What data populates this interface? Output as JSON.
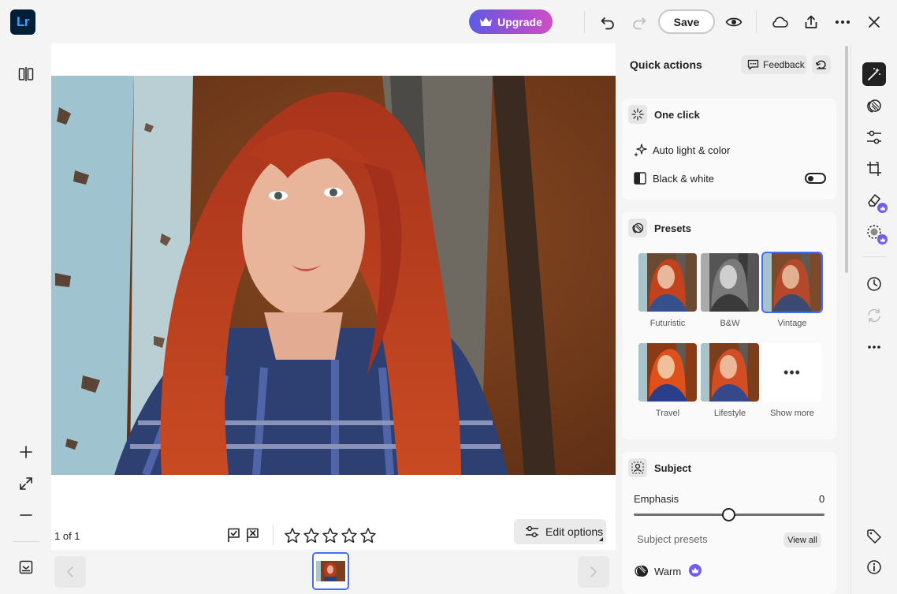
{
  "app": {
    "logo_text": "Lr",
    "upgrade_label": "Upgrade",
    "save_label": "Save",
    "accent": "#4a6cf0",
    "upgrade_gradient": [
      "#5c5ce0",
      "#d04fc4"
    ]
  },
  "toolbar_icons": [
    "undo-icon",
    "redo-icon",
    "eye-icon",
    "cloud-icon",
    "share-icon",
    "more-icon",
    "close-icon"
  ],
  "left_rail_icons": [
    "compare-icon",
    "zoom-in-icon",
    "fit-icon",
    "zoom-out-icon",
    "filmstrip-toggle-icon"
  ],
  "canvas": {
    "counter": "1 of 1",
    "flag_icons": [
      "pick-flag-icon",
      "reject-flag-icon"
    ],
    "stars": 5,
    "rating": 0,
    "edit_options_label": "Edit options"
  },
  "panel": {
    "title": "Quick actions",
    "feedback_label": "Feedback",
    "one_click": {
      "title": "One click",
      "auto_label": "Auto light & color",
      "bw_label": "Black & white",
      "bw_on": false
    },
    "presets": {
      "title": "Presets",
      "items": [
        {
          "label": "Futuristic",
          "style": "futuristic",
          "selected": false
        },
        {
          "label": "B&W",
          "style": "bw",
          "selected": false
        },
        {
          "label": "Vintage",
          "style": "vintage",
          "selected": true
        },
        {
          "label": "Travel",
          "style": "travel",
          "selected": false
        },
        {
          "label": "Lifestyle",
          "style": "lifestyle",
          "selected": false
        }
      ],
      "show_more_label": "Show more",
      "show_more_glyph": "•••"
    },
    "subject": {
      "title": "Subject",
      "emphasis_label": "Emphasis",
      "emphasis_value": "0",
      "subject_presets_label": "Subject presets",
      "view_all_label": "View all",
      "warm_label": "Warm"
    }
  },
  "right_toolbar_icons": [
    "quick-actions-icon",
    "presets-icon",
    "adjust-icon",
    "crop-icon",
    "remove-icon",
    "masking-icon",
    "history-icon",
    "versions-icon",
    "more-icon",
    "tag-icon",
    "info-icon"
  ]
}
